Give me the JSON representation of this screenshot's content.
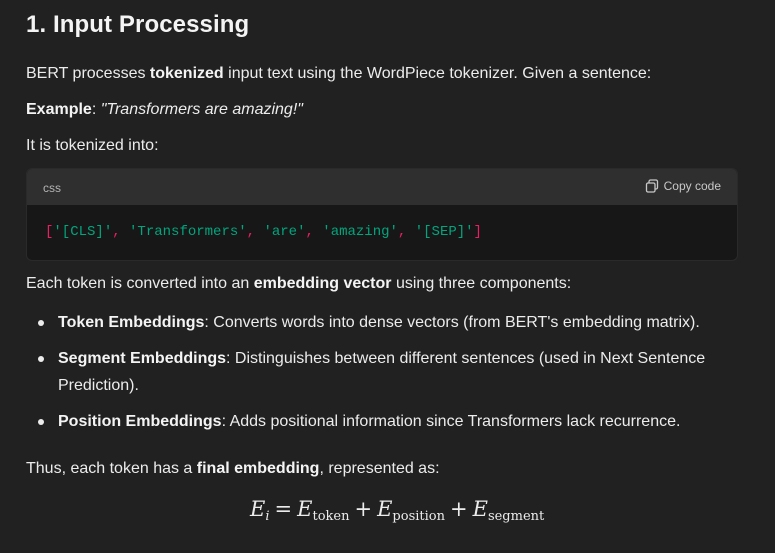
{
  "section": {
    "title": "1. Input Processing"
  },
  "intro": {
    "pre": "BERT processes ",
    "bold": "tokenized",
    "post": " input text using the WordPiece tokenizer. Given a sentence:"
  },
  "example": {
    "label": "Example",
    "sep": ": ",
    "text": "\"Transformers are amazing!\""
  },
  "tokenized_line": "It is tokenized into:",
  "code": {
    "language": "css",
    "copy_label": "Copy code",
    "open": "[",
    "close": "]",
    "comma": ", ",
    "tokens": [
      "'[CLS]'",
      "'Transformers'",
      "'are'",
      "'amazing'",
      "'[SEP]'"
    ]
  },
  "embed_intro": {
    "pre": "Each token is converted into an ",
    "bold": "embedding vector",
    "post": " using three components:"
  },
  "bullets": [
    {
      "bold": "Token Embeddings",
      "text": ": Converts words into dense vectors (from BERT's embedding matrix)."
    },
    {
      "bold": "Segment Embeddings",
      "text": ": Distinguishes between different sentences (used in Next Sentence Prediction)."
    },
    {
      "bold": "Position Embeddings",
      "text": ": Adds positional information since Transformers lack recurrence."
    }
  ],
  "final": {
    "pre": "Thus, each token has a ",
    "bold": "final embedding",
    "post": ", represented as:"
  },
  "formula": {
    "lhs": "E",
    "lhs_sub": "i",
    "eq": "=",
    "plus": "+",
    "term": "E",
    "sub1": "token",
    "sub2": "position",
    "sub3": "segment"
  },
  "colors": {
    "background": "#212121",
    "code_background": "#171717",
    "code_header": "#2f2f2f",
    "punctuation": "#e91e63",
    "string": "#00a67d"
  },
  "icons": {
    "copy": "copy-icon"
  }
}
